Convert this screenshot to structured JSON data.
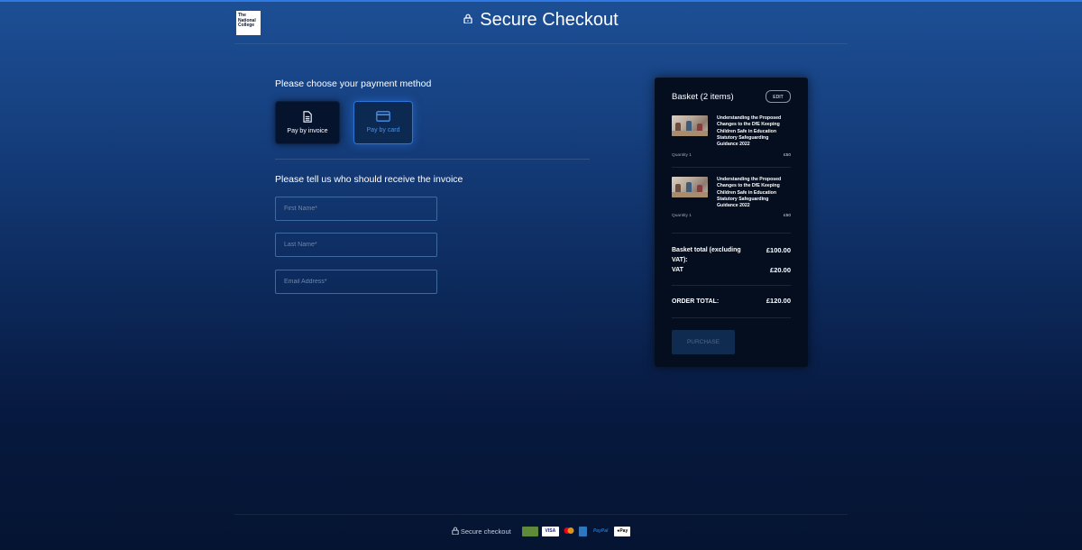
{
  "header": {
    "title": "Secure Checkout",
    "logo_text": "The National College"
  },
  "payment": {
    "title": "Please choose your payment method",
    "options": [
      {
        "label": "Pay by invoice",
        "icon": "document-icon"
      },
      {
        "label": "Pay by card",
        "icon": "credit-card-icon",
        "selected": true
      }
    ]
  },
  "invoice": {
    "title": "Please tell us who should receive the invoice",
    "first_name_placeholder": "First Name*",
    "last_name_placeholder": "Last Name*",
    "email_placeholder": "Email Address*"
  },
  "basket": {
    "title": "Basket (2 items)",
    "edit_label": "EDIT",
    "items": [
      {
        "name": "Understanding the Proposed Changes to the DfE Keeping Children Safe in Education Statutory Safeguarding Guidance 2022",
        "quantity": "Quantity 1",
        "price": "£50"
      },
      {
        "name": "Understanding the Proposed Changes to the DfE Keeping Children Safe in Education Statutory Safeguarding Guidance 2022",
        "quantity": "Quantity 1",
        "price": "£50"
      }
    ],
    "total_excl_label": "Basket total (excluding VAT):",
    "total_excl_value": "£100.00",
    "vat_label": "VAT",
    "vat_value": "£20.00",
    "order_total_label": "ORDER TOTAL:",
    "order_total_value": "£120.00",
    "purchase_label": "PURCHASE"
  },
  "footer": {
    "text": "Secure checkout",
    "payment_logos": [
      "VISA",
      "PayPal",
      "Pay"
    ]
  },
  "colors": {
    "accent": "#2f7ae5",
    "card_selected_text": "#4a90ea"
  }
}
